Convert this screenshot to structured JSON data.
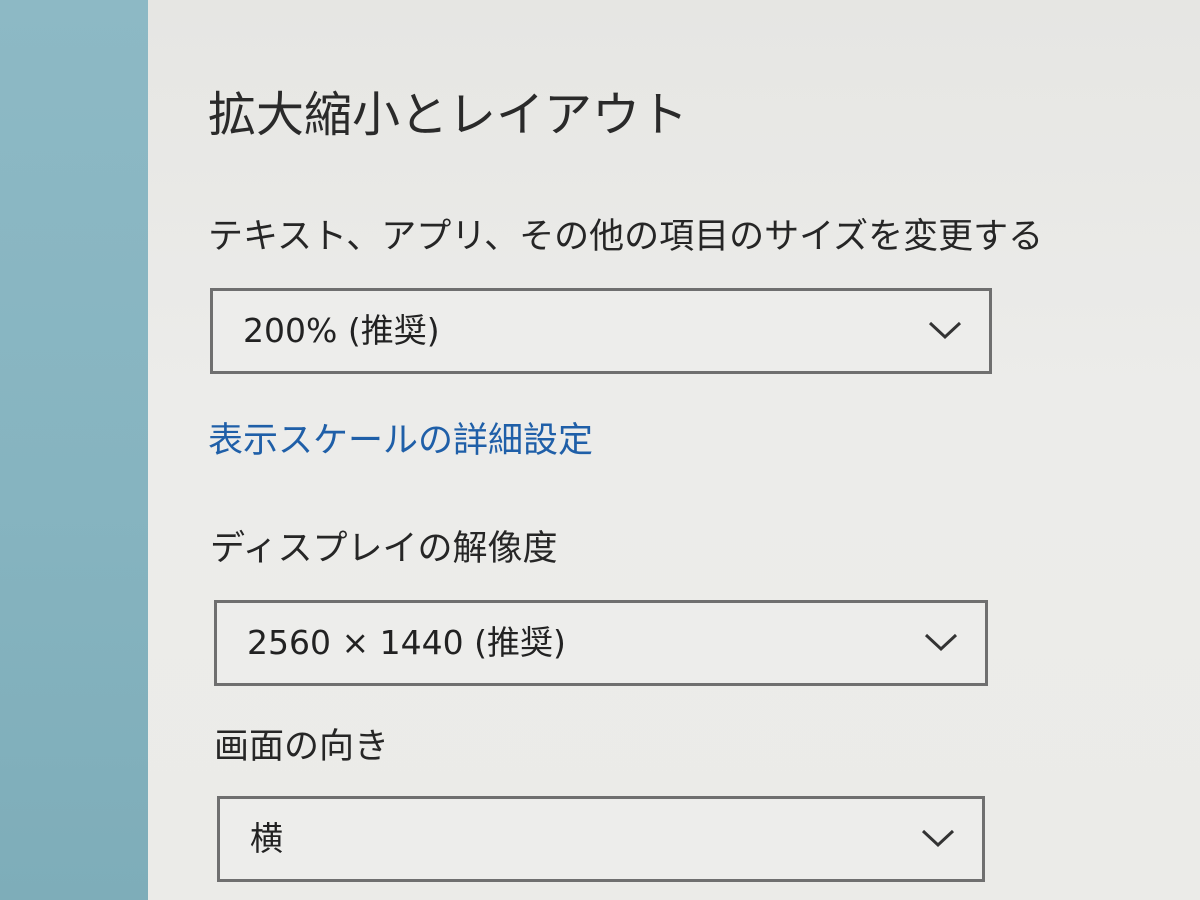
{
  "section": {
    "title": "拡大縮小とレイアウト"
  },
  "scale": {
    "label": "テキスト、アプリ、その他の項目のサイズを変更する",
    "selected": "200% (推奨)"
  },
  "advanced_scaling_link": "表示スケールの詳細設定",
  "resolution": {
    "label": "ディスプレイの解像度",
    "selected": "2560 × 1440 (推奨)"
  },
  "orientation": {
    "label": "画面の向き",
    "selected": "横"
  },
  "icons": {
    "dropdown_arrow": "chevron-down-icon"
  },
  "colors": {
    "link": "#1f5fa8",
    "sidebar": "#86b4c0",
    "background": "#ebebe8",
    "dropdown_border": "#6f6f6f"
  }
}
